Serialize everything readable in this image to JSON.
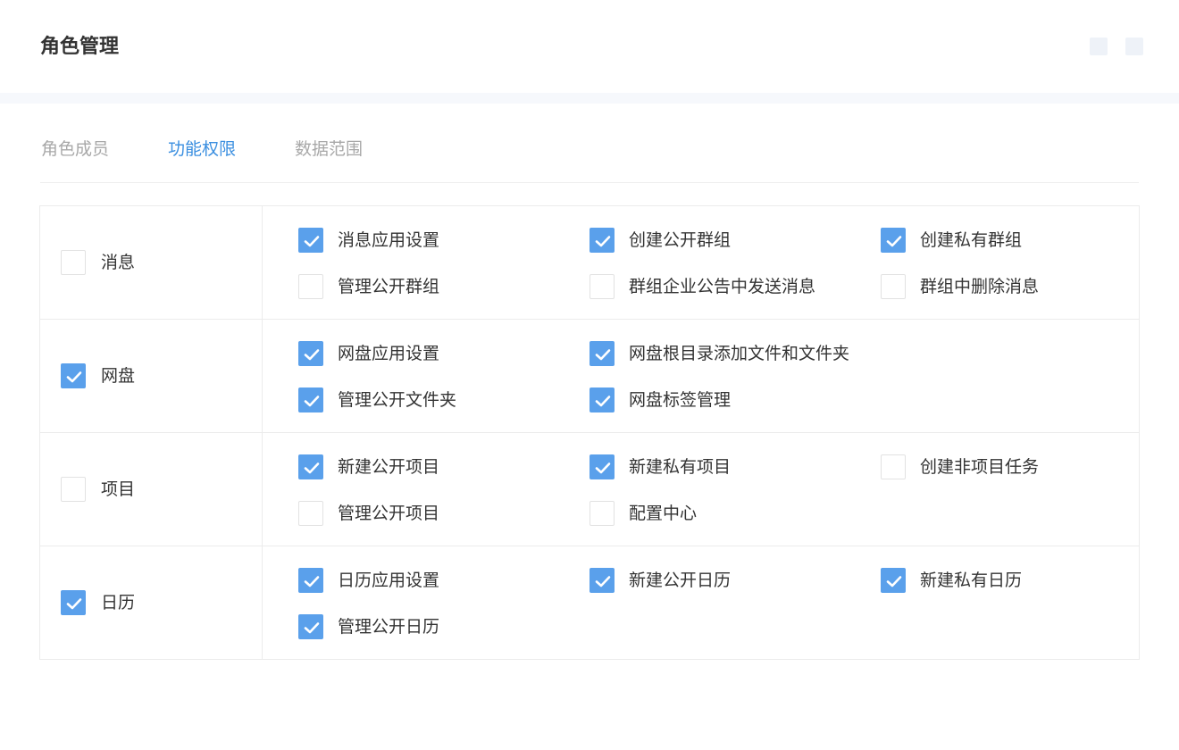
{
  "header": {
    "title": "角色管理"
  },
  "tabs": [
    {
      "label": "角色成员",
      "active": false
    },
    {
      "label": "功能权限",
      "active": true
    },
    {
      "label": "数据范围",
      "active": false
    }
  ],
  "colors": {
    "accent": "#3b8fe0",
    "checkbox_checked": "#5aa0eb",
    "tab_inactive": "#a8a8a8"
  },
  "groups": [
    {
      "label": "消息",
      "checked": false,
      "items": [
        {
          "label": "消息应用设置",
          "checked": true
        },
        {
          "label": "创建公开群组",
          "checked": true
        },
        {
          "label": "创建私有群组",
          "checked": true
        },
        {
          "label": "管理公开群组",
          "checked": false
        },
        {
          "label": "群组企业公告中发送消息",
          "checked": false
        },
        {
          "label": "群组中删除消息",
          "checked": false
        }
      ]
    },
    {
      "label": "网盘",
      "checked": true,
      "items": [
        {
          "label": "网盘应用设置",
          "checked": true
        },
        {
          "label": "网盘根目录添加文件和文件夹",
          "checked": true
        },
        {
          "label": "管理公开文件夹",
          "checked": true
        },
        {
          "label": "网盘标签管理",
          "checked": true
        }
      ]
    },
    {
      "label": "项目",
      "checked": false,
      "items": [
        {
          "label": "新建公开项目",
          "checked": true
        },
        {
          "label": "新建私有项目",
          "checked": true
        },
        {
          "label": "创建非项目任务",
          "checked": false
        },
        {
          "label": "管理公开项目",
          "checked": false
        },
        {
          "label": "配置中心",
          "checked": false
        }
      ]
    },
    {
      "label": "日历",
      "checked": true,
      "items": [
        {
          "label": "日历应用设置",
          "checked": true
        },
        {
          "label": "新建公开日历",
          "checked": true
        },
        {
          "label": "新建私有日历",
          "checked": true
        },
        {
          "label": "管理公开日历",
          "checked": true
        }
      ]
    }
  ]
}
